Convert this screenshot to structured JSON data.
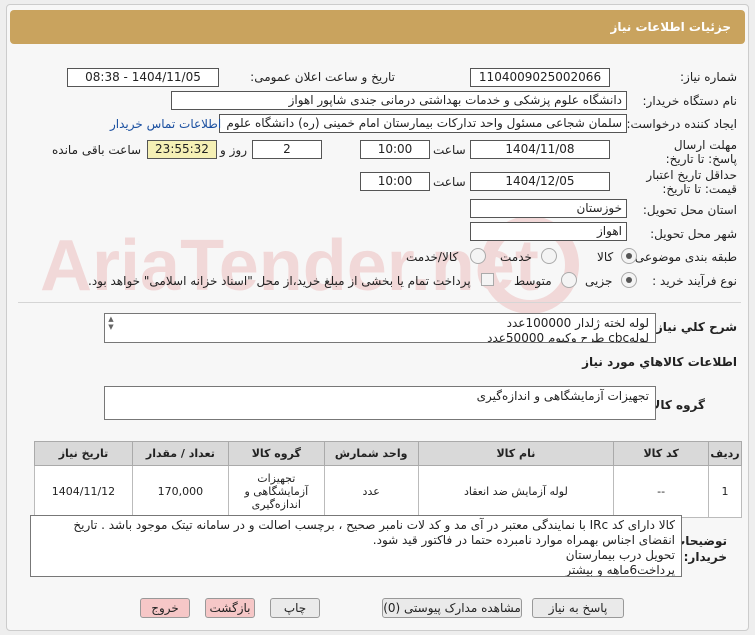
{
  "header": {
    "title": "جزئیات اطلاعات نیاز"
  },
  "form": {
    "need_number_label": "شماره نیاز:",
    "need_number": "1104009025002066",
    "announce_label": "تاریخ و ساعت اعلان عمومی:",
    "announce_value": "1404/11/05 - 08:38",
    "buyer_org_label": "نام دستگاه خریدار:",
    "buyer_org": "دانشگاه علوم پزشکی و خدمات بهداشتی درمانی جندی شاپور اهواز",
    "creator_label": "ایجاد کننده درخواست:",
    "creator": "سلمان شجاعی مسئول واحد تدارکات بیمارستان امام خمینی (ره) دانشگاه علوم",
    "contact_link": "اطلاعات تماس خریدار",
    "reply_deadline_label": "مهلت ارسال پاسخ: تا تاریخ:",
    "reply_date": "1404/11/08",
    "time_label": "ساعت",
    "reply_time": "10:00",
    "days": "2",
    "days_label": "روز و",
    "remaining_time": "23:55:32",
    "remaining_label": "ساعت باقی مانده",
    "validity_label": "حداقل تاریخ اعتبار قیمت: تا تاریخ:",
    "validity_date": "1404/12/05",
    "validity_time": "10:00",
    "province_label": "استان محل تحویل:",
    "province": "خوزستان",
    "city_label": "شهر محل تحویل:",
    "city": "اهواز",
    "category_label": "طبقه بندی موضوعی:",
    "category_options": [
      "کالا",
      "خدمت",
      "کالا/خدمت"
    ],
    "process_label": "نوع فرآیند خرید :",
    "process_options": [
      "جزیی",
      "متوسط"
    ],
    "process_note": "پرداخت تمام یا بخشی از مبلغ خرید،از محل \"اسناد خزانه اسلامی\" خواهد بود."
  },
  "summary": {
    "label": "شرح کلي نياز:",
    "line1": "لوله لخته ژلدار 100000عدد",
    "line2": "لولهcbc    طرح وکیوم    50000عدد"
  },
  "goods_info": {
    "title": "اطلاعات کالاهاي مورد نياز",
    "group_label": "گروه کالا:",
    "group_value": "تجهیزات آزمایشگاهی و اندازه‌گیری"
  },
  "table": {
    "headers": [
      "ردیف",
      "کد کالا",
      "نام کالا",
      "واحد شمارش",
      "گروه کالا",
      "تعداد / مقدار",
      "تاریخ نیاز"
    ],
    "rows": [
      {
        "row": "1",
        "code": "--",
        "name": "لوله آزمایش ضد انعقاد",
        "unit": "عدد",
        "group": "تجهیزات آزمایشگاهی و اندازه‌گیری",
        "qty": "170,000",
        "date": "1404/11/12"
      }
    ]
  },
  "buyer_notes": {
    "label": "توضیحات خریدار:",
    "lines": [
      "کالا دارای کد IRc با نمایندگی معتبر در آی مد و کد لات نامبر صحیح ، برچسب اصالت و در سامانه تیتک موجود باشد . تاریخ",
      "انقضای اجناس بهمراه موارد نامبرده حتما در فاکتور قید شود.",
      "تحویل درب بیمارستان",
      "پرداخت6ماهه و بیشتر"
    ]
  },
  "buttons": {
    "reply": "پاسخ به نیاز",
    "attachments": "مشاهده مدارک پیوستی (0)",
    "print": "چاپ",
    "back": "بازگشت",
    "exit": "خروج"
  },
  "watermark": {
    "text": "AriaTender.net"
  },
  "colors": {
    "header": "#c9a35e",
    "link": "#1a4fa0",
    "pink_button": "#f6c7c7",
    "remaining_bg": "#f5f0b5"
  }
}
